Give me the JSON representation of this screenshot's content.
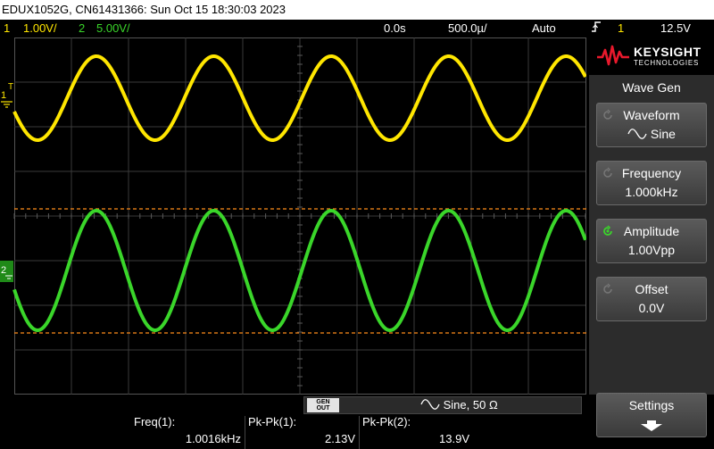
{
  "title_bar": {
    "text": "EDUX1052G, CN61431366: Sun Oct 15 18:30:03 2023"
  },
  "status": {
    "ch1_num": "1",
    "ch1_scale": "1.00V/",
    "ch2_num": "2",
    "ch2_scale": "5.00V/",
    "delay": "0.0s",
    "timebase": "500.0µ/",
    "trigger_mode": "Auto",
    "trigger_icon": "rising-edge-icon",
    "trigger_source": "1",
    "trigger_level": "12.5V"
  },
  "markers": {
    "ch1_label": "1",
    "ch1_trig": "T",
    "ch2_label": "2"
  },
  "brand": {
    "name": "KEYSIGHT",
    "sub": "TECHNOLOGIES"
  },
  "menu": {
    "title": "Wave Gen",
    "keys": [
      {
        "label": "Waveform",
        "value": "Sine",
        "icon": "sine-wave-icon"
      },
      {
        "label": "Frequency",
        "value": "1.000kHz"
      },
      {
        "label": "Amplitude",
        "value": "1.00Vpp"
      },
      {
        "label": "Offset",
        "value": "0.0V"
      }
    ],
    "settings": "Settings"
  },
  "gen": {
    "button_top": "GEN",
    "button_bottom": "OUT",
    "info": "Sine, 50 Ω"
  },
  "measurements": [
    {
      "label": "Freq(1):",
      "value": "1.0016kHz"
    },
    {
      "label": "Pk-Pk(1):",
      "value": "2.13V"
    },
    {
      "label": "Pk-Pk(2):",
      "value": "13.9V"
    }
  ],
  "colors": {
    "ch1": "#ffe600",
    "ch2": "#3ad62a",
    "cursor": "#ff8c1a",
    "grid": "#3a3a3a"
  }
}
